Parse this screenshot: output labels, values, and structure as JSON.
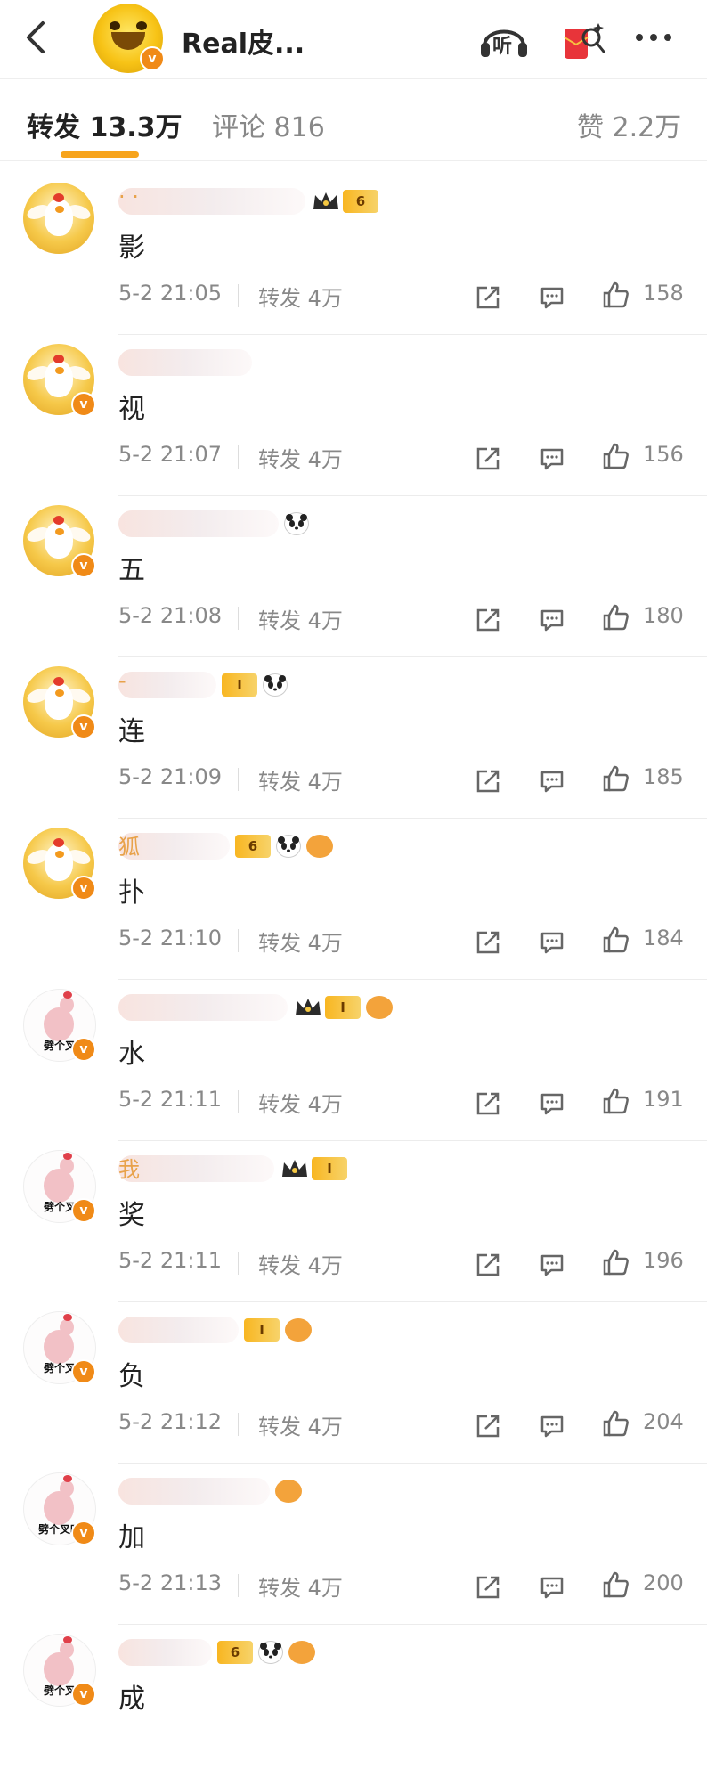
{
  "header": {
    "title": "Real皮...",
    "verified_mark": "v",
    "icons": [
      "back-chevron-icon",
      "listen-headphone-icon",
      "red-envelope-search-icon",
      "more-icon"
    ],
    "listen_label": "听"
  },
  "tabs": [
    {
      "label": "转发 13.3万",
      "active": true
    },
    {
      "label": "评论 816",
      "active": false
    },
    {
      "label": "赞 2.2万",
      "active": false
    }
  ],
  "colors": {
    "accent": "#f7a41c",
    "verified": "#f08a17",
    "gray_text": "#888888"
  },
  "items": [
    {
      "lead": "· ·",
      "text": "影",
      "time": "5-2 21:05",
      "repost": "转发 4万",
      "likes": "158",
      "badges": [
        "crown-level-badge"
      ],
      "verified_level": "6",
      "avatar": "chick-avatar"
    },
    {
      "lead": "",
      "text": "视",
      "time": "5-2 21:07",
      "repost": "转发 4万",
      "likes": "156",
      "badges": [],
      "avatar": "chick-avatar"
    },
    {
      "lead": "",
      "text": "五",
      "time": "5-2 21:08",
      "repost": "转发 4万",
      "likes": "180",
      "badges": [
        "panda-icon"
      ],
      "avatar": "chick-avatar"
    },
    {
      "lead": "-",
      "text": "连",
      "time": "5-2 21:09",
      "repost": "转发 4万",
      "likes": "185",
      "badges": [
        "level-badge",
        "panda-icon"
      ],
      "level_text": "I",
      "avatar": "chick-avatar"
    },
    {
      "lead": "狐",
      "text": "扑",
      "time": "5-2 21:10",
      "repost": "转发 4万",
      "likes": "184",
      "badges": [
        "level-badge",
        "panda-icon",
        "fish-icon"
      ],
      "avatar": "chick-avatar"
    },
    {
      "lead": "",
      "text": "水",
      "time": "5-2 21:11",
      "repost": "转发 4万",
      "likes": "191",
      "badges": [
        "crown-level-badge",
        "fish-icon"
      ],
      "level_text": "I",
      "avatar": "hen-avatar",
      "avatar_caption": "劈个叉"
    },
    {
      "lead": "我",
      "text": "奖",
      "time": "5-2 21:11",
      "repost": "转发 4万",
      "likes": "196",
      "badges": [
        "crown-level-badge"
      ],
      "level_text": "I",
      "avatar": "hen-avatar",
      "avatar_caption": "劈个叉"
    },
    {
      "lead": "",
      "text": "负",
      "time": "5-2 21:12",
      "repost": "转发 4万",
      "likes": "204",
      "badges": [
        "level-badge",
        "fish-icon"
      ],
      "level_text": "I",
      "avatar": "hen-avatar",
      "avatar_caption": "劈个叉"
    },
    {
      "lead": "",
      "text": "加",
      "time": "5-2 21:13",
      "repost": "转发 4万",
      "likes": "200",
      "badges": [
        "fish-icon"
      ],
      "avatar": "hen-avatar",
      "avatar_caption": "劈个叉吧"
    },
    {
      "lead": "",
      "text": "成",
      "time": "",
      "repost": "",
      "likes": "",
      "badges": [
        "level-badge",
        "panda-icon",
        "fish-icon"
      ],
      "avatar": "hen-avatar",
      "avatar_caption": "劈个叉"
    }
  ]
}
